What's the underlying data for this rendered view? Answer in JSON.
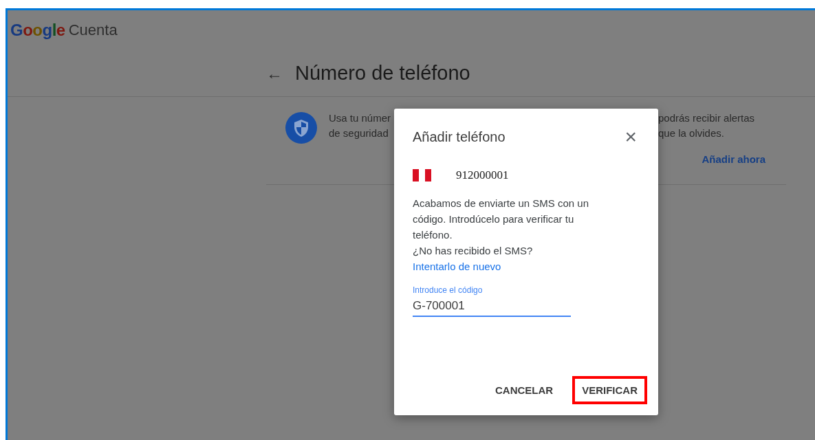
{
  "header": {
    "logo": "Google",
    "product": "Cuenta"
  },
  "page": {
    "back": "←",
    "title": "Número de teléfono"
  },
  "card": {
    "left_lines": [
      "Usa tu númer",
      "de seguridad"
    ],
    "right_lines": [
      "podrás recibir alertas",
      "que la olvides."
    ],
    "action": "Añadir ahora"
  },
  "dialog": {
    "title": "Añadir teléfono",
    "close": "×",
    "phone": "912000001",
    "message": "Acabamos de enviarte un SMS con un código. Introdúcelo para verificar tu teléfono.",
    "retry_prompt": "¿No has recibido el SMS?",
    "retry_link": "Intentarlo de nuevo",
    "field": {
      "label": "Introduce el código",
      "value": "G-700001",
      "focused": true
    },
    "buttons": [
      {
        "label": "CANCELAR",
        "highlighted": false
      },
      {
        "label": "VERIFICAR",
        "highlighted": true
      }
    ]
  }
}
